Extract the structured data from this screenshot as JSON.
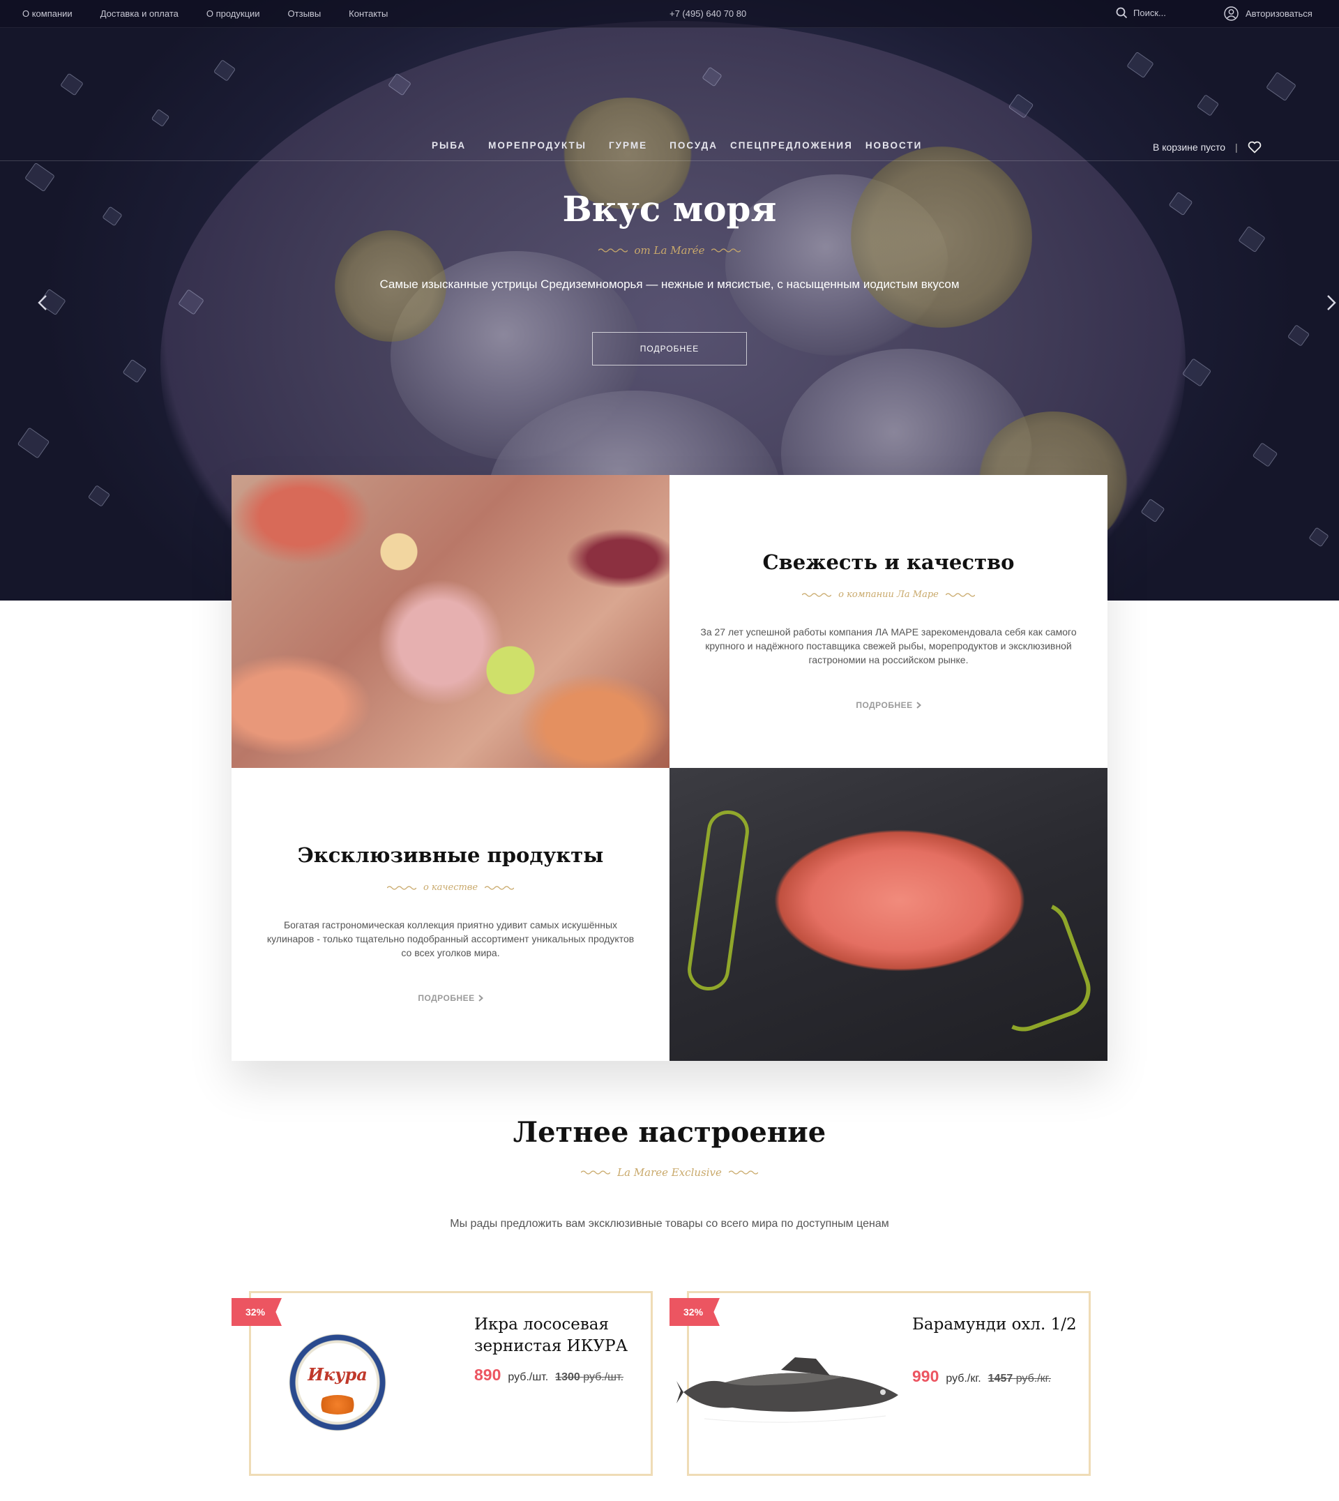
{
  "topbar": {
    "nav": [
      "О компании",
      "Доставка и оплата",
      "О продукции",
      "Отзывы",
      "Контакты"
    ],
    "phone": "+7 (495) 640 70 80",
    "search_label": "Поиск...",
    "login_label": "Авторизоваться"
  },
  "mainnav": {
    "items": [
      "РЫБА",
      "МОРЕПРОДУКТЫ",
      "ГУРМЕ",
      "ПОСУДА",
      "СПЕЦПРЕДЛОЖЕНИЯ",
      "НОВОСТИ"
    ],
    "cart_label": "В корзине пусто",
    "separator": "|"
  },
  "hero": {
    "title": "Вкус моря",
    "subtitle": "от La Marée",
    "description": "Самые изысканные устрицы Средиземноморья — нежные и мясистые, с насыщенным иодистым вкусом",
    "button": "ПОДРОБНЕЕ"
  },
  "features": {
    "freshness": {
      "title": "Свежесть и качество",
      "subtitle": "о компании Ла Маре",
      "text": "За 27 лет успешной работы компания ЛА МАРЕ зарекомендовала себя как самого крупного и надёжного поставщика свежей рыбы, морепродуктов и эксклюзивной гастрономии на российском рынке.",
      "more": "ПОДРОБНЕЕ"
    },
    "exclusive": {
      "title": "Эксклюзивные продукты",
      "subtitle": "о качестве",
      "text": "Богатая гастрономическая коллекция приятно удивит самых искушённых кулинаров - только тщательно подобранный ассортимент уникальных продуктов со всех уголков мира.",
      "more": "ПОДРОБНЕЕ"
    }
  },
  "summer": {
    "title": "Летнее настроение",
    "subtitle": "La Maree Exclusive",
    "description": "Мы рады предложить вам эксклюзивные товары со всего мира по доступным ценам"
  },
  "products": [
    {
      "discount": "32%",
      "name": "Икра лососевая зернистая ИКУРА",
      "price": "890",
      "unit": "руб./шт.",
      "old_price": "1300",
      "old_unit": "руб./шт.",
      "image_label": "Икура"
    },
    {
      "discount": "32%",
      "name": "Барамунди охл. 1/2",
      "price": "990",
      "unit": "руб./кг.",
      "old_price": "1457",
      "old_unit": "руб./кг."
    }
  ],
  "colors": {
    "accent_gold": "#c9a96b",
    "sale_red": "#ec5561",
    "card_border": "#efdcb6",
    "hero_dark": "#1c1d35"
  },
  "icons": [
    "search-icon",
    "user-icon",
    "heart-icon",
    "chevron-left-icon",
    "chevron-right-icon",
    "chevron-right-small-icon"
  ]
}
